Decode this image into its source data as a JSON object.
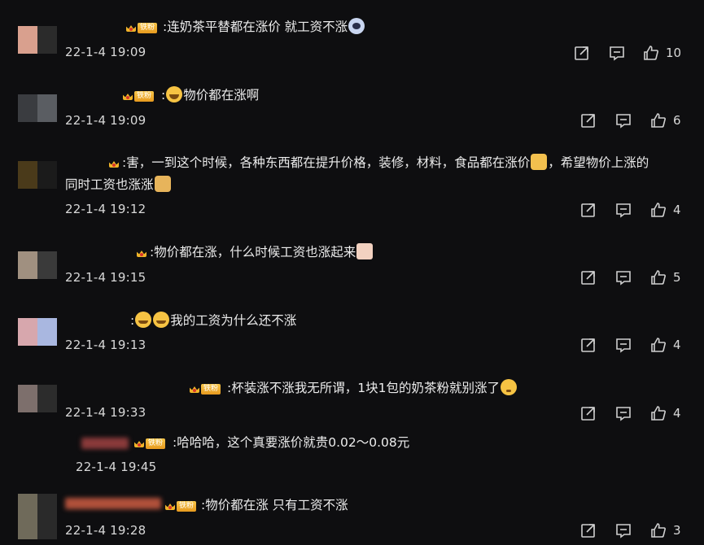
{
  "comments": [
    {
      "text": ":连奶茶平替都在涨价 就工资不涨",
      "emoji_tail": "ghost-emoji",
      "time": "22-1-4 19:09",
      "likes": "10",
      "badge": "铁粉"
    },
    {
      "text": "物价都在涨啊",
      "emoji_lead": "laugh-emoji",
      "time": "22-1-4 19:09",
      "likes": "6",
      "badge": "铁粉"
    },
    {
      "text_part1": ":害，一到这个时候，各种东西都在提升价格，装修，材料，食品都在涨价",
      "text_part2": "，希望物价上涨的",
      "text_line2": "同时工资也涨涨",
      "time": "22-1-4 19:12",
      "likes": "4"
    },
    {
      "text": ":物价都在涨，什么时候工资也涨起来",
      "time": "22-1-4 19:15",
      "likes": "5"
    },
    {
      "text": "我的工资为什么还不涨",
      "time": "22-1-4 19:13",
      "likes": "4"
    },
    {
      "text": ":杯装涨不涨我无所谓，1块1包的奶茶粉就别涨了",
      "time": "22-1-4 19:33",
      "likes": "4",
      "badge": "铁粉"
    },
    {
      "text": ":哈哈哈，这个真要涨价就贵0.02～0.08元",
      "time": "22-1-4 19:45",
      "badge": "铁粉"
    },
    {
      "text": ":物价都在涨 只有工资不涨",
      "time": "22-1-4 19:28",
      "likes": "3",
      "badge": "铁粉"
    }
  ],
  "colors": {
    "background": "#0e0e10",
    "text": "#ececec",
    "icon": "#cfcfcf",
    "badge_gold": "#f0b429"
  },
  "icons": [
    "share-icon",
    "comment-icon",
    "like-icon",
    "crown-icon"
  ]
}
